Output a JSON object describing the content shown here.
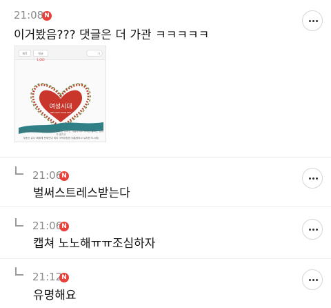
{
  "comments": [
    {
      "time": "21:08",
      "badge": "N",
      "text": "이거봤음??? 댓글은 더 가관 ㅋㅋㅋㅋㅋ",
      "is_reply": false,
      "has_image": true,
      "image": {
        "tabs": [
          "제목",
          "댓글",
          "1,000"
        ],
        "search_label": "가",
        "heart_title": "여성시대",
        "heart_subtitle": "WE LOVE YOUR LIFE",
        "caption_line1": "(대선이 다가오면서 또 혐한 등 정치인 관련 무조건 차별하셔도 되지만 발하는 행위가 생기고",
        "caption_line2": "부동산 유나 폐쇄에 문제인이 비리 국적부정한 대통령하고 유치한 도시에)"
      }
    },
    {
      "time": "21:06",
      "badge": "N",
      "text": "벌써스트레스받는다",
      "is_reply": true
    },
    {
      "time": "21:06",
      "badge": "N",
      "text": "캡쳐 노노해ㅠㅠ조심하자",
      "is_reply": true
    },
    {
      "time": "21:12",
      "badge": "N",
      "text": "유명해요",
      "is_reply": true
    }
  ],
  "colors": {
    "badge": "#e8413a",
    "time": "#8a8a8a",
    "heart": "#c9372c",
    "censor_mark": "#2f7f86"
  },
  "icons": {
    "badge": "new-badge-icon",
    "more": "more-options-icon",
    "reply": "reply-arrow-icon"
  }
}
